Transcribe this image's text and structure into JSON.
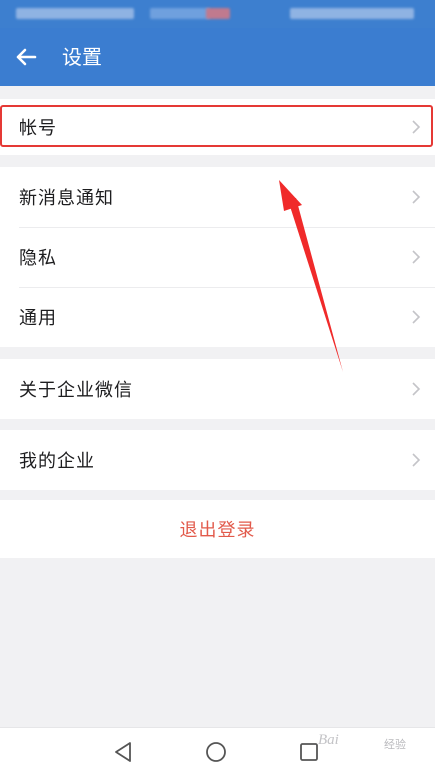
{
  "status_bar": {},
  "header": {
    "title": "设置",
    "back_icon": "arrow-left-icon"
  },
  "settings": {
    "account": {
      "label": "帐号"
    },
    "notifications": {
      "label": "新消息通知"
    },
    "privacy": {
      "label": "隐私"
    },
    "general": {
      "label": "通用"
    },
    "about": {
      "label": "关于企业微信"
    },
    "my_company": {
      "label": "我的企业"
    },
    "logout": {
      "label": "退出登录"
    }
  },
  "annotation": {
    "highlight_color": "#e53935",
    "arrow_color": "#f02a2a"
  },
  "colors": {
    "app_bar": "#3b7dd0",
    "background": "#f1f1f3",
    "logout_text": "#e25a4b"
  },
  "nav": {
    "back_icon": "triangle-back-icon",
    "home_icon": "circle-home-icon",
    "recent_icon": "square-recent-icon"
  },
  "watermark": {
    "text": "Bai",
    "sub": "经验"
  }
}
